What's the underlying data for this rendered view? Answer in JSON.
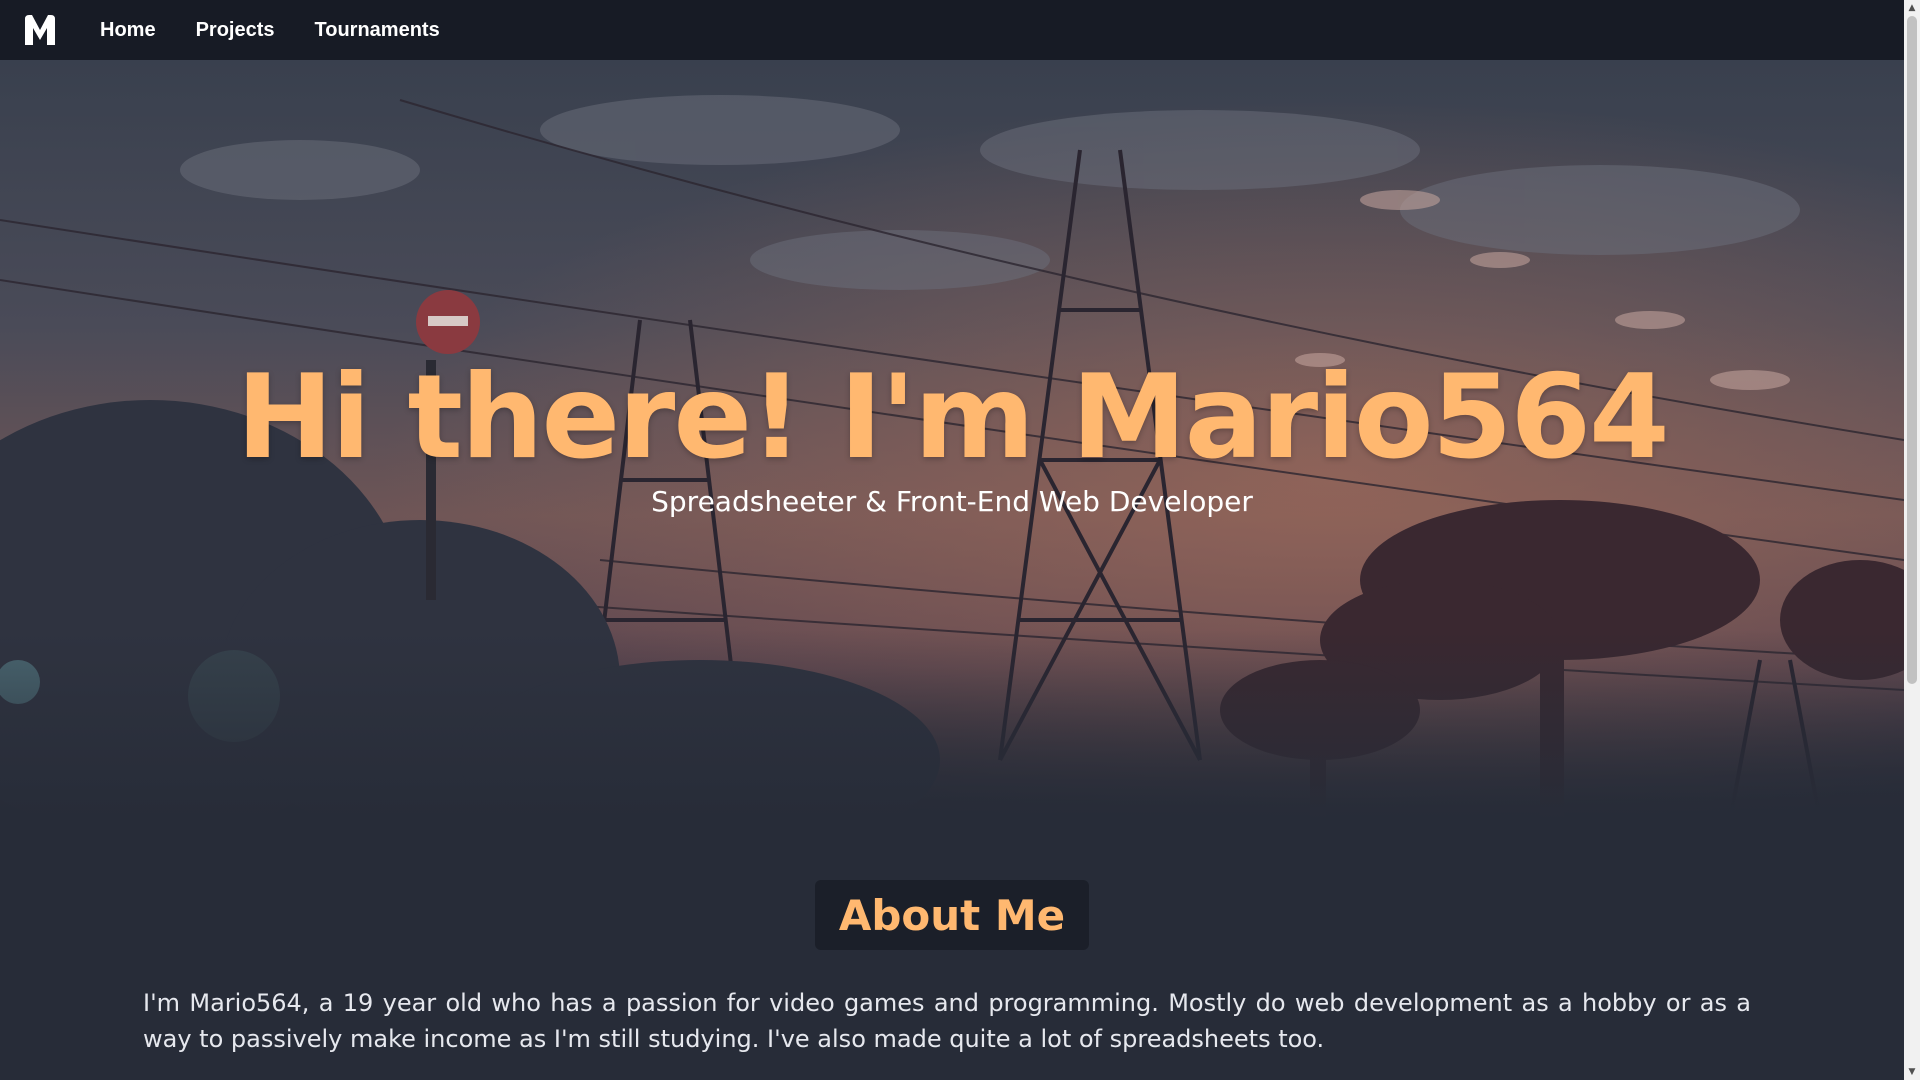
{
  "navbar": {
    "logo_icon": "m-logo-icon",
    "links": [
      "Home",
      "Projects",
      "Tournaments"
    ]
  },
  "hero": {
    "title": "Hi there! I'm Mario564",
    "subtitle": "Spreadsheeter & Front-End Web Developer"
  },
  "about": {
    "heading": "About Me",
    "text": "I'm Mario564, a 19 year old who has a passion for video games and programming. Mostly do web development as a hobby or as a way to passively make income as I'm still studying. I've also made quite a lot of spreadsheets too."
  },
  "scrollbar": {
    "up_icon": "chevron-up-icon",
    "down_icon": "chevron-down-icon"
  },
  "colors": {
    "accent": "#ffb870",
    "navbar_bg": "#171b25",
    "page_bg": "#272c38",
    "heading_bg": "#1b1f29"
  }
}
